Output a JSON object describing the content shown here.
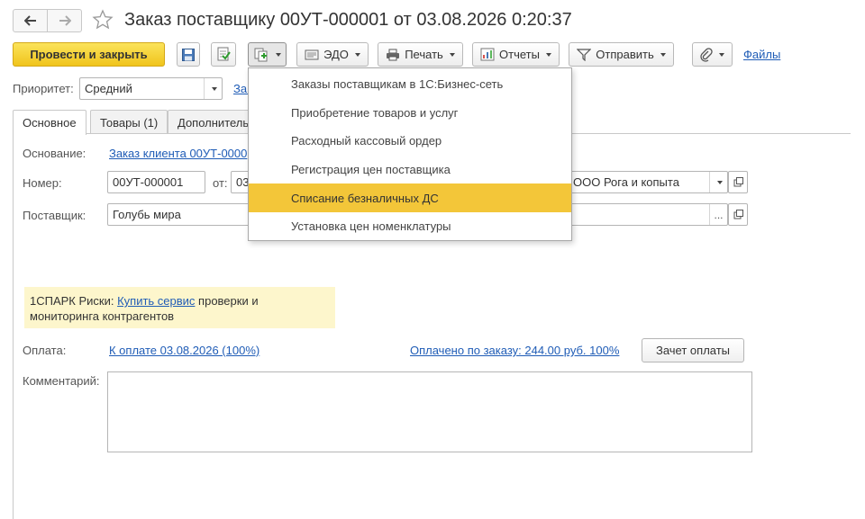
{
  "window": {
    "title": "Заказ поставщику 00УТ-000001 от 03.08.2026 0:20:37"
  },
  "toolbar": {
    "post_close_label": "Провести и закрыть",
    "edo_label": "ЭДО",
    "print_label": "Печать",
    "reports_label": "Отчеты",
    "send_label": "Отправить",
    "files_label": "Файлы"
  },
  "priority": {
    "label": "Приоритет:",
    "value": "Средний",
    "link": "Зап"
  },
  "tabs": [
    {
      "label": "Основное"
    },
    {
      "label": "Товары (1)"
    },
    {
      "label": "Дополнитель"
    }
  ],
  "form": {
    "basis_label": "Основание:",
    "basis_link": "Заказ клиента 00УТ-0000",
    "number_label": "Номер:",
    "number_value": "00УТ-000001",
    "date_label": "от:",
    "date_value": "03",
    "organization_value": "ООО Рога и копыта",
    "supplier_label": "Поставщик:",
    "supplier_value": "Голубь мира"
  },
  "spark": {
    "prefix": "1СПАРК Риски: ",
    "link": "Купить сервис",
    "suffix": " проверки и мониторинга контрагентов"
  },
  "payment": {
    "label": "Оплата:",
    "link": "К оплате 03.08.2026 (100%)",
    "paid_link": "Оплачено по заказу: 244.00 руб. 100%",
    "offset_button": "Зачет оплаты"
  },
  "comment": {
    "label": "Комментарий:",
    "value": ""
  },
  "create_menu": {
    "items": [
      {
        "label": "Заказы поставщикам в 1С:Бизнес-сеть"
      },
      {
        "label": "Приобретение товаров и услуг"
      },
      {
        "label": "Расходный кассовый ордер"
      },
      {
        "label": "Регистрация цен поставщика"
      },
      {
        "label": "Списание безналичных ДС"
      },
      {
        "label": "Установка цен номенклатуры"
      }
    ],
    "highlighted_index": 4
  },
  "colors": {
    "accent_yellow": "#f3c639",
    "link_blue": "#1f5cb6",
    "spark_bg": "#fdf6cc"
  }
}
